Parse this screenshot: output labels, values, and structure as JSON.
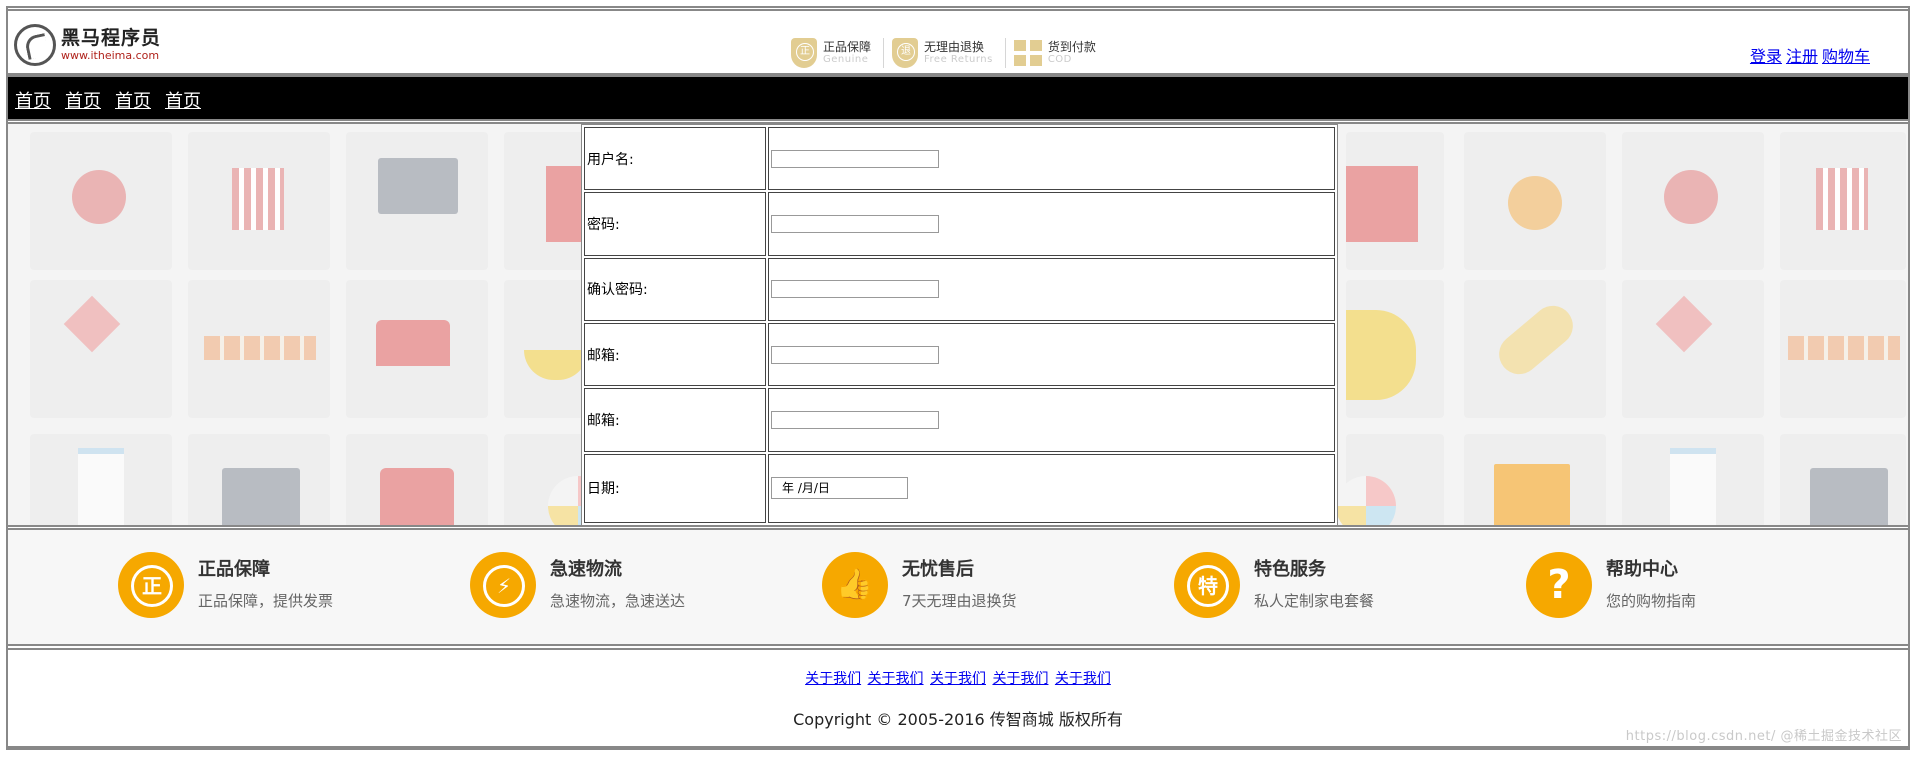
{
  "header": {
    "logo_cn": "黑马程序员",
    "logo_url": "www.itheima.com",
    "promises": [
      {
        "title": "正品保障",
        "sub": "Genuine",
        "icon": "shield-genuine-icon"
      },
      {
        "title": "无理由退换",
        "sub": "Free Returns",
        "icon": "shield-returns-icon"
      },
      {
        "title": "货到付款",
        "sub": "COD",
        "icon": "package-icon"
      }
    ],
    "links": {
      "login": "登录",
      "register": "注册",
      "cart": "购物车"
    }
  },
  "nav": {
    "items": [
      "首页",
      "首页",
      "首页",
      "首页"
    ]
  },
  "form": {
    "rows": [
      {
        "label": "用户名:",
        "value": ""
      },
      {
        "label": "密码:",
        "value": ""
      },
      {
        "label": "确认密码:",
        "value": ""
      },
      {
        "label": "邮箱:",
        "value": ""
      },
      {
        "label": "邮箱:",
        "value": ""
      },
      {
        "label": "日期:",
        "value": "年 /月/日"
      }
    ]
  },
  "services": [
    {
      "title": "正品保障",
      "sub": "正品保障，提供发票",
      "icon": "genuine-icon",
      "glyph": "正"
    },
    {
      "title": "急速物流",
      "sub": "急速物流，急速送达",
      "icon": "logistics-icon",
      "glyph": "⚡"
    },
    {
      "title": "无忧售后",
      "sub": "7天无理由退换货",
      "icon": "thumbs-up-icon",
      "glyph": "👍"
    },
    {
      "title": "特色服务",
      "sub": "私人定制家电套餐",
      "icon": "special-service-icon",
      "glyph": "特"
    },
    {
      "title": "帮助中心",
      "sub": "您的购物指南",
      "icon": "help-icon",
      "glyph": "?"
    }
  ],
  "footer": {
    "links": [
      "关于我们",
      "关于我们",
      "关于我们",
      "关于我们",
      "关于我们"
    ],
    "copyright": "Copyright © 2005-2016 传智商城 版权所有",
    "watermark": "https://blog.csdn.net/  @稀土掘金技术社区"
  },
  "colors": {
    "accent": "#f6a800",
    "nav_bg": "#000000",
    "link": "#0000ee",
    "promise_gold": "#e2cd92"
  }
}
